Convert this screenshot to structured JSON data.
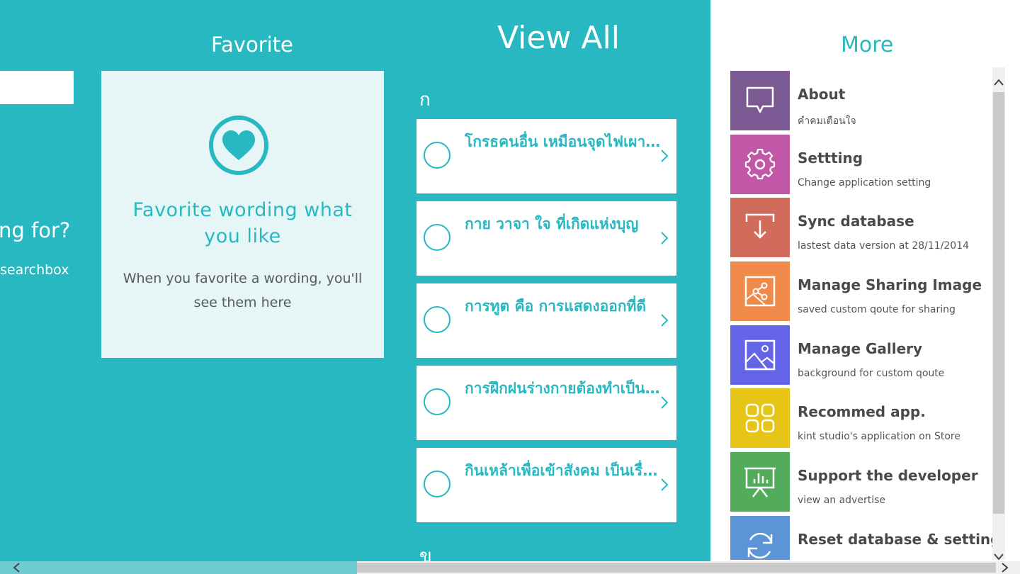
{
  "search_panel": {
    "hint_title": "ng for?",
    "hint_sub": "searchbox"
  },
  "favorite": {
    "title": "Favorite",
    "heading": "Favorite wording what you like",
    "description": "When you favorite a wording, you'll see them here"
  },
  "view_all": {
    "title": "View All",
    "group_letter": "ก",
    "next_group_letter": "ข",
    "items": [
      {
        "text": "โกรธคนอื่น เหมือนจุดไฟเผาตัวเอง"
      },
      {
        "text": "กาย วาจา ใจ ที่เกิดแห่งบุญ"
      },
      {
        "text": "การทูต คือ การแสดงออกที่ดี"
      },
      {
        "text": "การฝึกฝนร่างกายต้องทำเป็นประจำ"
      },
      {
        "text": "กินเหล้าเพื่อเข้าสังคม เป็นเรื่องเสีย"
      }
    ]
  },
  "more": {
    "title": "More",
    "items": [
      {
        "label": "About",
        "sub": "คำคมเตือนใจ",
        "color": "#7b5a94",
        "icon": "speech-bubble-icon"
      },
      {
        "label": "Settting",
        "sub": "Change application setting",
        "color": "#c257a7",
        "icon": "gear-icon"
      },
      {
        "label": "Sync database",
        "sub": "lastest data version at 28/11/2014",
        "color": "#d16b5b",
        "icon": "download-icon"
      },
      {
        "label": "Manage Sharing Image",
        "sub": "saved custom qoute for sharing",
        "color": "#f08a4b",
        "icon": "share-image-icon"
      },
      {
        "label": "Manage Gallery",
        "sub": "background for custom qoute",
        "color": "#6465e6",
        "icon": "image-icon"
      },
      {
        "label": "Recommed app.",
        "sub": "kint studio's application on Store",
        "color": "#e6c517",
        "icon": "apps-grid-icon"
      },
      {
        "label": "Support the developer",
        "sub": "view an advertise",
        "color": "#53ac5a",
        "icon": "presentation-chart-icon"
      },
      {
        "label": "Reset database & setting",
        "sub": "",
        "color": "#5b95d8",
        "icon": "refresh-icon"
      }
    ]
  },
  "colors": {
    "accent": "#28b8c2",
    "favorite_card_bg": "#e6f6f7"
  }
}
